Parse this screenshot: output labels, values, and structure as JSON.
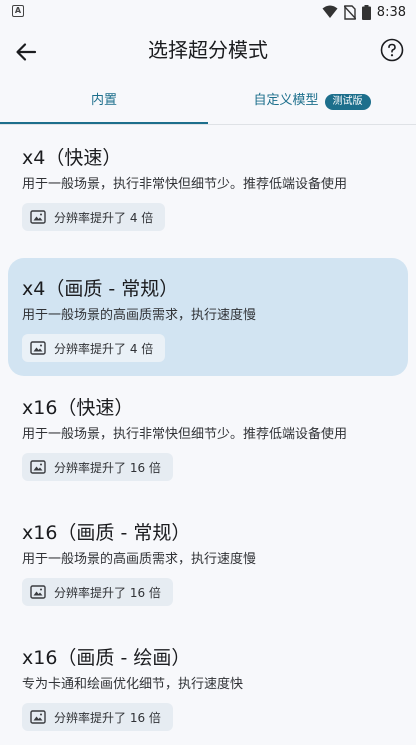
{
  "status_bar": {
    "time": "8:38",
    "icons": [
      "notification-a-icon",
      "wifi-icon",
      "no-sim-icon",
      "battery-icon"
    ]
  },
  "app_bar": {
    "title": "选择超分模式",
    "back_icon": "arrow-left-icon",
    "help_icon": "help-circle-icon"
  },
  "tabs": [
    {
      "label": "内置",
      "selected": true
    },
    {
      "label": "自定义模型",
      "badge": "测试版",
      "selected": false
    }
  ],
  "colors": {
    "accent": "#1d6f8c",
    "selected_card": "#d2e4f2",
    "chip": "#e6ecf2"
  },
  "modes": [
    {
      "title": "x4（快速）",
      "description": "用于一般场景，执行非常快但细节少。推荐低端设备使用",
      "chip": "分辨率提升了 4 倍",
      "selected": false
    },
    {
      "title": "x4（画质 - 常规）",
      "description": "用于一般场景的高画质需求，执行速度慢",
      "chip": "分辨率提升了 4 倍",
      "selected": true
    },
    {
      "title": "x16（快速）",
      "description": "用于一般场景，执行非常快但细节少。推荐低端设备使用",
      "chip": "分辨率提升了 16 倍",
      "selected": false
    },
    {
      "title": "x16（画质 - 常规）",
      "description": "用于一般场景的高画质需求，执行速度慢",
      "chip": "分辨率提升了 16 倍",
      "selected": false
    },
    {
      "title": "x16（画质 - 绘画）",
      "description": "专为卡通和绘画优化细节，执行速度快",
      "chip": "分辨率提升了 16 倍",
      "selected": false
    }
  ]
}
